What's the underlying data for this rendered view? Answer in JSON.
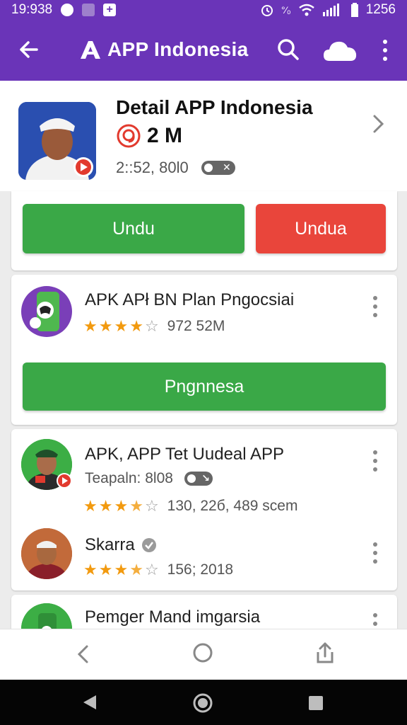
{
  "status_bar": {
    "time": "19:938",
    "battery": "1256"
  },
  "app_bar": {
    "title": "APP Indonesia"
  },
  "detail": {
    "title": "Detail APP Indonesia",
    "count": "2 M",
    "meta": "2::52, 80l0"
  },
  "action_buttons": {
    "left_label": "Undu",
    "right_label": "Undua"
  },
  "card1": {
    "title": "APK APł BN Plan Pngocsiai",
    "rating_text": "972 52M",
    "button_label": "Pngnnesa"
  },
  "card2": {
    "item1": {
      "title": "APK, APP Tet Uudeal APP",
      "subtitle": "Teapaln: 8l08",
      "rating_text": "130, 22б, 489 scem"
    },
    "item2": {
      "title": "Skarra",
      "rating_text": "156; 2018"
    }
  },
  "card3": {
    "title": "Pemger Mand imgarsia"
  },
  "colors": {
    "brand": "#6a34b8",
    "green": "#3aa847",
    "red": "#e9453b",
    "star": "#f29a0f"
  }
}
